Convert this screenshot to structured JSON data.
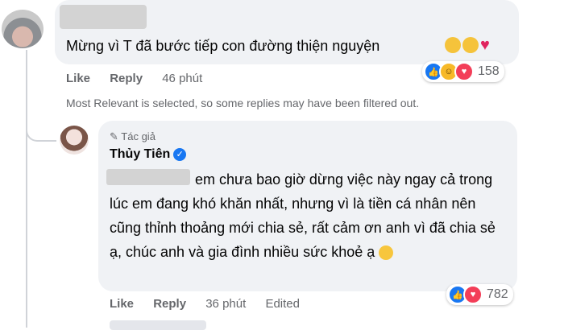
{
  "top_comment": {
    "text": "Mừng vì T đã bước tiếp con đường thiện nguyện",
    "reaction_count": "158",
    "actions": {
      "like": "Like",
      "reply": "Reply",
      "time": "46 phút"
    }
  },
  "filter_note": "Most Relevant is selected, so some replies may have been filtered out.",
  "reply": {
    "tag": "Tác giả",
    "author": "Thủy Tiên",
    "text": "em chưa bao giờ dừng việc này ngay cả trong lúc em đang khó khăn nhất, nhưng vì là tiền cá nhân nên cũng thỉnh thoảng mới chia sẻ, rất cảm ơn anh vì đã chia sẻ ạ, chúc anh và gia đình nhiều sức khoẻ ạ",
    "reaction_count": "782",
    "actions": {
      "like": "Like",
      "reply": "Reply",
      "time": "36 phút",
      "edited": "Edited"
    }
  },
  "icons": {
    "like": "like-icon",
    "haha": "haha-icon",
    "love": "love-icon",
    "verified": "verified-badge-icon",
    "pen": "pen-icon"
  },
  "colors": {
    "bubble": "#f0f2f5",
    "like_blue": "#1877f2",
    "love_red": "#f33e58",
    "muted": "#65676b"
  }
}
